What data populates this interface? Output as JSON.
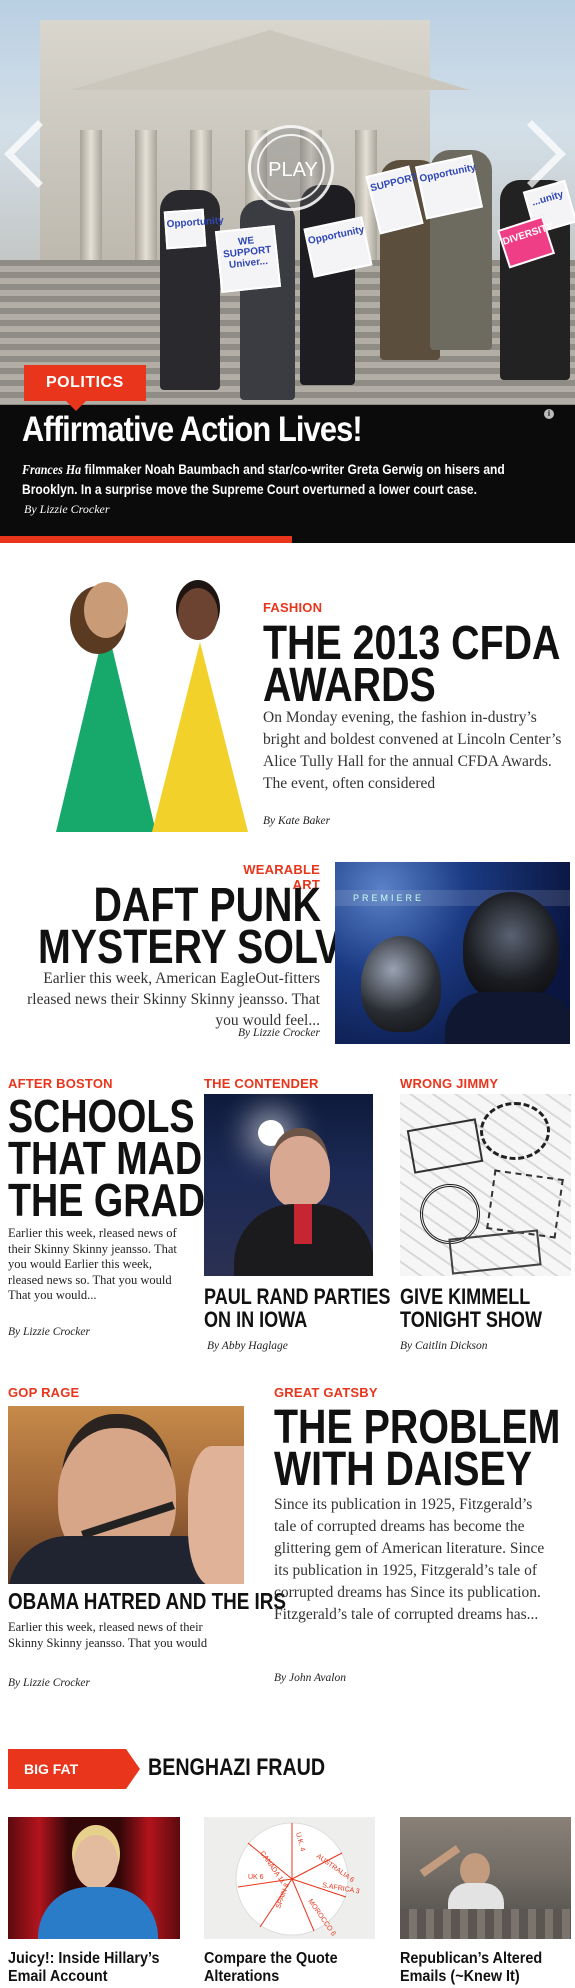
{
  "hero": {
    "category": "POLITICS",
    "play_label": "PLAY",
    "title": "Affirmative Action Lives!",
    "dek_italic": "Frances Ha",
    "dek_rest": " filmmaker Noah Baumbach and  star/co-writer Greta Gerwig on hisers and Brooklyn. In a surprise move the Supreme Court overturned a lower court case.",
    "byline": "By Lizzie Crocker",
    "info_icon": "i",
    "signs": [
      "Opportunity",
      "WE SUPPORT Univer...",
      "Opportunity",
      "SUPPORT...",
      "Opportunity",
      "...unity",
      "DIVERSITY"
    ]
  },
  "cfda": {
    "label": "FASHION",
    "title_line1": "THE 2013 CFDA",
    "title_line2": "AWARDS",
    "body": "On Monday evening, the fashion in-dustry’s bright and boldest convened at Lincoln Center’s Alice Tully Hall for the annual CFDA Awards. The event, often considered",
    "byline": "By Kate Baker"
  },
  "daft": {
    "label": "WEARABLE ART",
    "title_line1": "DAFT PUNK",
    "title_line2": "MYSTERY SOLVED",
    "body": "Earlier this week, American EagleOut-fitters rleased news their Skinny Skinny jeansso. That you would feel...",
    "byline": "By Lizzie Crocker",
    "image_text": "PREMIERE"
  },
  "schools": {
    "label": "AFTER BOSTON",
    "title_line1": "SCHOOLS",
    "title_line2": "THAT MADE",
    "title_line3": "THE GRADE",
    "body": "Earlier this week, rleased news of their Skinny Skinny jeansso. That you would Earlier this week, rleased news so. That you would That you would...",
    "byline": "By Lizzie Crocker"
  },
  "rand": {
    "label": "THE CONTENDER",
    "title_line1": "PAUL RAND PARTIES",
    "title_line2": "ON IN IOWA",
    "byline": "By Abby Haglage"
  },
  "kimmell": {
    "label": "WRONG JIMMY",
    "title_line1": "GIVE KIMMELL",
    "title_line2": "TONIGHT SHOW",
    "byline": "By Caitlin Dickson"
  },
  "obama": {
    "label": "GOP RAGE",
    "title": "OBAMA HATRED AND THE IRS",
    "body": "Earlier this week, rleased news of their Skinny Skinny jeansso. That you would",
    "byline": "By Lizzie Crocker"
  },
  "gatsby": {
    "label": "GREAT GATSBY",
    "title_line1": "THE PROBLEM",
    "title_line2": "WITH DAISEY",
    "body": "Since its publication in 1925, Fitzgerald’s tale of corrupted dreams has become the glittering gem of American literature.  Since its publication in 1925, Fitzgerald’s tale of corrupted dreams has Since its publication. Fitzgerald’s tale of corrupted dreams has...",
    "byline": "By John Avalon"
  },
  "big_fat_story": {
    "tag": "BIG FAT STORY",
    "title": "BENGHAZI FRAUD",
    "items": [
      {
        "line1": "Juicy!: Inside Hillary’s",
        "line2": "Email Account"
      },
      {
        "line1": "Compare the Quote",
        "line2": "Alterations"
      },
      {
        "line1": "Republican’s Altered",
        "line2": "Emails (~Knew It)"
      }
    ],
    "wheel_labels": [
      "CANADA 11",
      "U.K. 4",
      "AUSTRALIA 6",
      "S.AFRICA 3",
      "MOROCCO 6",
      "SPAIN 8",
      "UK 6"
    ]
  },
  "colors": {
    "accent": "#e8351c",
    "hero_bg": "#0b0b0b",
    "fashion_green": "#17a86c",
    "fashion_yellow": "#f1d12a"
  }
}
